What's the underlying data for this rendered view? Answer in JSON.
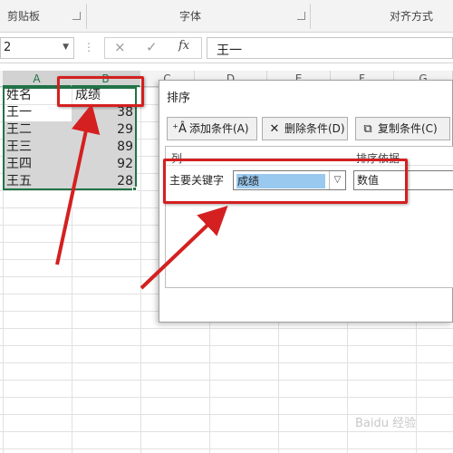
{
  "ribbon": {
    "groups": [
      {
        "label": "剪贴板"
      },
      {
        "label": "字体"
      },
      {
        "label": "对齐方式"
      }
    ]
  },
  "formula_bar": {
    "name_box_value": "2",
    "cancel_icon": "×",
    "confirm_icon": "✓",
    "fx_label": "fx",
    "content": "王一"
  },
  "columns": [
    "A",
    "B",
    "C",
    "D",
    "E",
    "F",
    "G"
  ],
  "sheet": {
    "header": {
      "name": "姓名",
      "score": "成绩"
    },
    "rows": [
      {
        "name": "王一",
        "score": "38"
      },
      {
        "name": "王二",
        "score": "29"
      },
      {
        "name": "王三",
        "score": "89"
      },
      {
        "name": "王四",
        "score": "92"
      },
      {
        "name": "王五",
        "score": "28"
      }
    ]
  },
  "dialog": {
    "title": "排序",
    "toolbar": {
      "add_level": "添加条件(A)",
      "delete_level": "删除条件(D)",
      "copy_level": "复制条件(C)"
    },
    "list_headers": {
      "column": "列",
      "sort_on": "排序依据"
    },
    "primary_key_label": "主要关键字",
    "primary_key_value": "成绩",
    "sort_on_value": "数值"
  },
  "annotation_color": "#d42020",
  "watermark_text": "Baidu 经验"
}
